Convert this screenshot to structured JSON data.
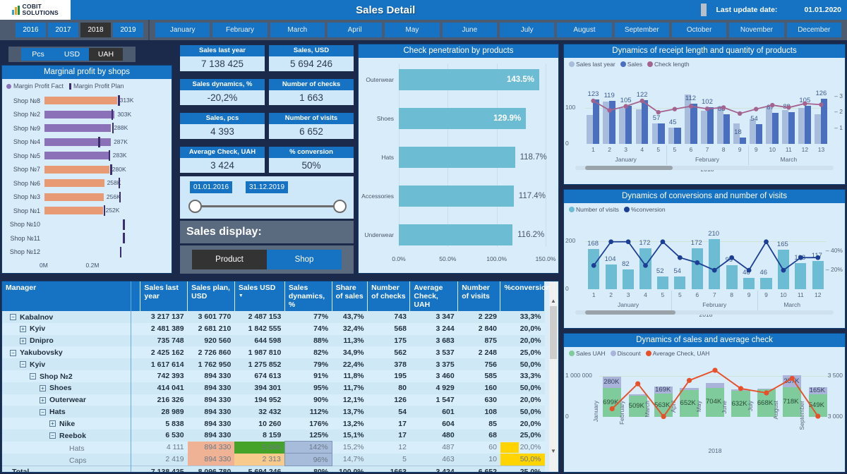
{
  "header": {
    "logo_line1": "COBIT",
    "logo_line2": "SOLUTIONS",
    "title": "Sales Detail",
    "update_label": "Last update date:",
    "update_date": "01.01.2020"
  },
  "filters": {
    "years": [
      "2016",
      "2017",
      "2018",
      "2019"
    ],
    "selected_year": "2018",
    "months": [
      "January",
      "February",
      "March",
      "April",
      "May",
      "June",
      "July",
      "August",
      "September",
      "October",
      "November",
      "December"
    ]
  },
  "units": {
    "options": [
      "Pcs",
      "USD",
      "UAH"
    ],
    "selected": "UAH"
  },
  "marginal_profit": {
    "title": "Marginal profit by shops",
    "legend_fact": "Margin Profit Fact",
    "legend_plan": "Margin Profit Plan",
    "axis_ticks": [
      "0M",
      "0.2M"
    ],
    "rows": [
      {
        "shop": "Shop №8",
        "value": 313000,
        "label": "313K",
        "plan": 318000,
        "color": "#e89a75"
      },
      {
        "shop": "Shop №2",
        "value": 303000,
        "label": "303K",
        "plan": 289000,
        "color": "#8b72b8"
      },
      {
        "shop": "Shop №9",
        "value": 288000,
        "label": "288K",
        "plan": 292000,
        "color": "#8b72b8"
      },
      {
        "shop": "Shop №4",
        "value": 287000,
        "label": "287K",
        "plan": 232000,
        "color": "#8b72b8"
      },
      {
        "shop": "Shop №5",
        "value": 283000,
        "label": "283K",
        "plan": 277000,
        "color": "#8b72b8"
      },
      {
        "shop": "Shop №7",
        "value": 280000,
        "label": "280K",
        "plan": 284000,
        "color": "#e89a75"
      },
      {
        "shop": "Shop №6",
        "value": 258000,
        "label": "258K",
        "plan": 320000,
        "color": "#e89a75"
      },
      {
        "shop": "Shop №3",
        "value": 256000,
        "label": "256K",
        "plan": 322000,
        "color": "#e89a75"
      },
      {
        "shop": "Shop №1",
        "value": 252000,
        "label": "252K",
        "plan": 256000,
        "color": "#e89a75"
      },
      {
        "shop": "Shop №10",
        "value": 0,
        "label": "",
        "plan": 340000,
        "color": "#e89a75"
      },
      {
        "shop": "Shop №11",
        "value": 0,
        "label": "",
        "plan": 340000,
        "color": "#e89a75"
      },
      {
        "shop": "Shop №12",
        "value": 0,
        "label": "",
        "plan": 325000,
        "color": "#e89a75"
      }
    ]
  },
  "kpis": [
    {
      "label": "Sales last year",
      "value": "7 138 425"
    },
    {
      "label": "Sales, USD",
      "value": "5 694 246"
    },
    {
      "label": "Sales dynamics, %",
      "value": "-20,2%"
    },
    {
      "label": "Number of checks",
      "value": "1 663"
    },
    {
      "label": "Sales, pcs",
      "value": "4 393"
    },
    {
      "label": "Number of visits",
      "value": "6 652"
    },
    {
      "label": "Average Check, UAH",
      "value": "3 424"
    },
    {
      "label": "% conversion",
      "value": "50%"
    }
  ],
  "date_slider": {
    "from": "01.01.2016",
    "to": "31.12.2019"
  },
  "sales_display": {
    "label": "Sales display:",
    "product_label": "Product",
    "shop_label": "Shop",
    "selected": "Shop"
  },
  "check_penetration": {
    "title": "Check penetration by products",
    "axis_ticks": [
      "0.0%",
      "50.0%",
      "100.0%",
      "150.0%"
    ],
    "rows": [
      {
        "name": "Outerwear",
        "value": 143.5,
        "label": "143.5%",
        "inside": true
      },
      {
        "name": "Shoes",
        "value": 129.9,
        "label": "129.9%",
        "inside": true
      },
      {
        "name": "Hats",
        "value": 118.7,
        "label": "118.7%",
        "inside": false
      },
      {
        "name": "Accessories",
        "value": 117.4,
        "label": "117.4%",
        "inside": false
      },
      {
        "name": "Underwear",
        "value": 116.2,
        "label": "116.2%",
        "inside": false
      }
    ]
  },
  "chart_data": [
    {
      "id": "receipt",
      "type": "bar",
      "title": "Dynamics of receipt length and quantity of products",
      "legend": [
        "Sales last year",
        "Sales",
        "Check length"
      ],
      "legend_colors": [
        "#a8bcdc",
        "#4a6fbe",
        "#a4638f"
      ],
      "x": [
        "1",
        "2",
        "3",
        "4",
        "5",
        "5",
        "6",
        "7",
        "8",
        "9",
        "9",
        "10",
        "11",
        "12",
        "13"
      ],
      "month_groups": [
        {
          "label": "January",
          "span": 5
        },
        {
          "label": "February",
          "span": 5
        },
        {
          "label": "March",
          "span": 5
        }
      ],
      "year_label": "2018",
      "series": [
        {
          "name": "Sales last year",
          "values": [
            80,
            117,
            100,
            97,
            57,
            45,
            138,
            92,
            103,
            57,
            68,
            104,
            94,
            99,
            82
          ]
        },
        {
          "name": "Sales",
          "values": [
            123,
            119,
            105,
            122,
            57,
            45,
            112,
            102,
            83,
            18,
            54,
            87,
            89,
            105,
            126
          ],
          "labels": [
            "123",
            "119",
            "105",
            "122",
            "57",
            "45",
            "112",
            "102",
            "83",
            "18",
            "54",
            "87",
            "89",
            "105",
            "126"
          ]
        },
        {
          "name": "Check length",
          "values": [
            2.72,
            2.12,
            2.38,
            2.72,
            2.0,
            2.2,
            2.38,
            2.22,
            2.3,
            1.92,
            2.2,
            2.45,
            2.3,
            2.55,
            2.48
          ]
        }
      ],
      "ylabels": [
        "0",
        "100"
      ],
      "y2labels": [
        "1",
        "2",
        "3"
      ],
      "ylim": [
        0,
        145
      ],
      "grid": true
    },
    {
      "id": "conversions",
      "type": "bar",
      "title": "Dynamics of conversions and number of visits",
      "legend": [
        "Number of visits",
        "%conversion"
      ],
      "legend_colors": [
        "#6cbcd4",
        "#1c3f94"
      ],
      "x": [
        "1",
        "2",
        "3",
        "4",
        "5",
        "5",
        "6",
        "7",
        "8",
        "9",
        "9",
        "10",
        "11",
        "12"
      ],
      "month_groups": [
        {
          "label": "January",
          "span": 5
        },
        {
          "label": "February",
          "span": 5
        },
        {
          "label": "March",
          "span": 4
        }
      ],
      "year_label": "2018",
      "series": [
        {
          "name": "Number of visits",
          "values": [
            168,
            104,
            82,
            172,
            52,
            54,
            172,
            210,
            99,
            46,
            46,
            165,
            108,
            117
          ],
          "labels": [
            "168",
            "104",
            "82",
            "172",
            "52",
            "54",
            "172",
            "210",
            "99",
            "46",
            "46",
            "165",
            "108",
            "117"
          ]
        },
        {
          "name": "%conversion",
          "values": [
            25,
            50,
            50,
            25,
            50,
            33.3,
            28,
            20,
            33.3,
            20,
            50,
            20,
            33.3,
            33.3
          ]
        }
      ],
      "ylabels": [
        "0",
        "200"
      ],
      "y2labels": [
        "20%",
        "40%"
      ],
      "ylim": [
        0,
        230
      ],
      "grid": true
    },
    {
      "id": "sales_avg",
      "type": "bar",
      "title": "Dynamics of sales and average check",
      "legend": [
        "Sales UAH",
        "Discount",
        "Average Check, UAH"
      ],
      "legend_colors": [
        "#7fcb9b",
        "#aab4da",
        "#e8502a"
      ],
      "x": [
        "January",
        "February",
        "March",
        "April",
        "May",
        "June",
        "July",
        "August",
        "September"
      ],
      "year_label": "2018",
      "series": [
        {
          "name": "Sales UAH",
          "values": [
            699,
            509,
            563,
            652,
            704,
            632,
            668,
            718,
            549
          ],
          "labels": [
            "699K",
            "509K",
            "563K",
            "652K",
            "704K",
            "632K",
            "668K",
            "718K",
            "549K"
          ]
        },
        {
          "name": "Discount",
          "values": [
            280,
            45,
            169,
            48,
            120,
            42,
            20,
            287,
            165
          ],
          "labels": [
            "280K",
            "",
            "169K",
            "",
            "",
            "",
            "",
            "287K",
            "165K"
          ]
        },
        {
          "name": "Average Check, UAH",
          "values": [
            3120,
            3490,
            3005,
            3540,
            3690,
            3420,
            3355,
            3570,
            3010
          ]
        }
      ],
      "ylabels": [
        "0",
        "1 000 000"
      ],
      "y2labels": [
        "3 000",
        "3 500"
      ],
      "ylim": [
        0,
        1150
      ],
      "grid": true
    }
  ],
  "table": {
    "columns": [
      "Manager",
      "Sales last year",
      "Sales plan, USD",
      "Sales USD",
      "Sales dynamics, %",
      "Share of sales",
      "Number of checks",
      "Average Check, UAH",
      "Number of visits",
      "%conversion"
    ],
    "sorted_column": "Sales USD",
    "rows": [
      {
        "indent": 0,
        "toggle": "minus",
        "name": "Kabalnov",
        "cells": [
          "3 217 137",
          "3 601 770",
          "2 487 153",
          "77%",
          "43,7%",
          "743",
          "3 347",
          "2 229",
          "33,3%"
        ]
      },
      {
        "indent": 1,
        "toggle": "plus",
        "name": "Kyiv",
        "cells": [
          "2 481 389",
          "2 681 210",
          "1 842 555",
          "74%",
          "32,4%",
          "568",
          "3 244",
          "2 840",
          "20,0%"
        ]
      },
      {
        "indent": 1,
        "toggle": "plus",
        "name": "Dnipro",
        "cells": [
          "735 748",
          "920 560",
          "644 598",
          "88%",
          "11,3%",
          "175",
          "3 683",
          "875",
          "20,0%"
        ]
      },
      {
        "indent": 0,
        "toggle": "minus",
        "name": "Yakubovsky",
        "cells": [
          "2 425 162",
          "2 726 860",
          "1 987 810",
          "82%",
          "34,9%",
          "562",
          "3 537",
          "2 248",
          "25,0%"
        ]
      },
      {
        "indent": 1,
        "toggle": "minus",
        "name": "Kyiv",
        "cells": [
          "1 617 614",
          "1 762 950",
          "1 275 852",
          "79%",
          "22,4%",
          "378",
          "3 375",
          "756",
          "50,0%"
        ]
      },
      {
        "indent": 2,
        "toggle": "minus",
        "name": "Shop №2",
        "cells": [
          "742 393",
          "894 330",
          "674 613",
          "91%",
          "11,8%",
          "195",
          "3 460",
          "585",
          "33,3%"
        ]
      },
      {
        "indent": 3,
        "toggle": "plus",
        "name": "Shoes",
        "cells": [
          "414 041",
          "894 330",
          "394 301",
          "95%",
          "11,7%",
          "80",
          "4 929",
          "160",
          "50,0%"
        ]
      },
      {
        "indent": 3,
        "toggle": "plus",
        "name": "Outerwear",
        "cells": [
          "216 326",
          "894 330",
          "194 952",
          "90%",
          "12,1%",
          "126",
          "1 547",
          "630",
          "20,0%"
        ]
      },
      {
        "indent": 3,
        "toggle": "minus",
        "name": "Hats",
        "cells": [
          "28 989",
          "894 330",
          "32 432",
          "112%",
          "13,7%",
          "54",
          "601",
          "108",
          "50,0%"
        ]
      },
      {
        "indent": 4,
        "toggle": "plus",
        "name": "Nike",
        "cells": [
          "5 838",
          "894 330",
          "10 260",
          "176%",
          "13,2%",
          "17",
          "604",
          "85",
          "20,0%"
        ]
      },
      {
        "indent": 4,
        "toggle": "minus",
        "name": "Reebok",
        "cells": [
          "6 530",
          "894 330",
          "8 159",
          "125%",
          "15,1%",
          "17",
          "480",
          "68",
          "25,0%"
        ]
      },
      {
        "indent": 5,
        "toggle": "none",
        "name": "Hats",
        "light": true,
        "cells": [
          "4 111",
          "894 330",
          "5 846",
          "142%",
          "15,2%",
          "12",
          "487",
          "60",
          "20,0%"
        ],
        "highlight": {
          "2": "salmon",
          "3": "green",
          "4": "blue",
          "9": "yellow-partial"
        }
      },
      {
        "indent": 5,
        "toggle": "none",
        "name": "Caps",
        "light": true,
        "cells": [
          "2 419",
          "894 330",
          "2 313",
          "96%",
          "14,7%",
          "5",
          "463",
          "10",
          "50,0%"
        ],
        "highlight": {
          "2": "salmon",
          "3": "orange",
          "4": "blue",
          "9": "yellow-full"
        }
      }
    ],
    "total": {
      "name": "Total",
      "cells": [
        "7 138 425",
        "8 096 780",
        "5 694 246",
        "80%",
        "100,0%",
        "1663",
        "3 424",
        "6 652",
        "25,0%"
      ]
    }
  }
}
